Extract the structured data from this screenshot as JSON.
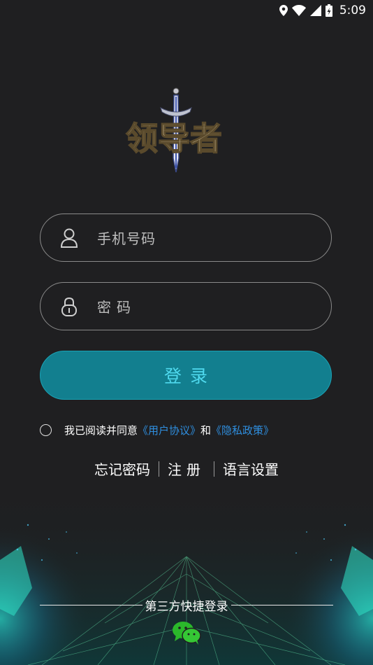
{
  "status_bar": {
    "time": "5:09",
    "icons": [
      "location-icon",
      "wifi-icon",
      "signal-icon",
      "battery-charging-icon"
    ]
  },
  "logo": {
    "text": "领导者",
    "icon": "sword-logo-icon"
  },
  "login_form": {
    "phone_placeholder": "手机号码",
    "password_placeholder": "密码",
    "phone_icon": "user-icon",
    "password_icon": "lock-icon",
    "login_label": "登录"
  },
  "agreement": {
    "prefix": "我已阅读并同意",
    "user_agreement": "《用户协议》",
    "conjunction": "和",
    "privacy_policy": "《隐私政策》",
    "checked": false
  },
  "links": {
    "forgot_password": "忘记密码",
    "register": "注册",
    "language_settings": "语言设置"
  },
  "third_party": {
    "label": "第三方快捷登录",
    "providers": [
      "wechat-icon"
    ]
  },
  "colors": {
    "background": "#1f1f21",
    "accent": "#127f8f",
    "accent_text": "#4fd9ee",
    "link": "#2f8fe0",
    "wechat": "#2bb82b"
  }
}
